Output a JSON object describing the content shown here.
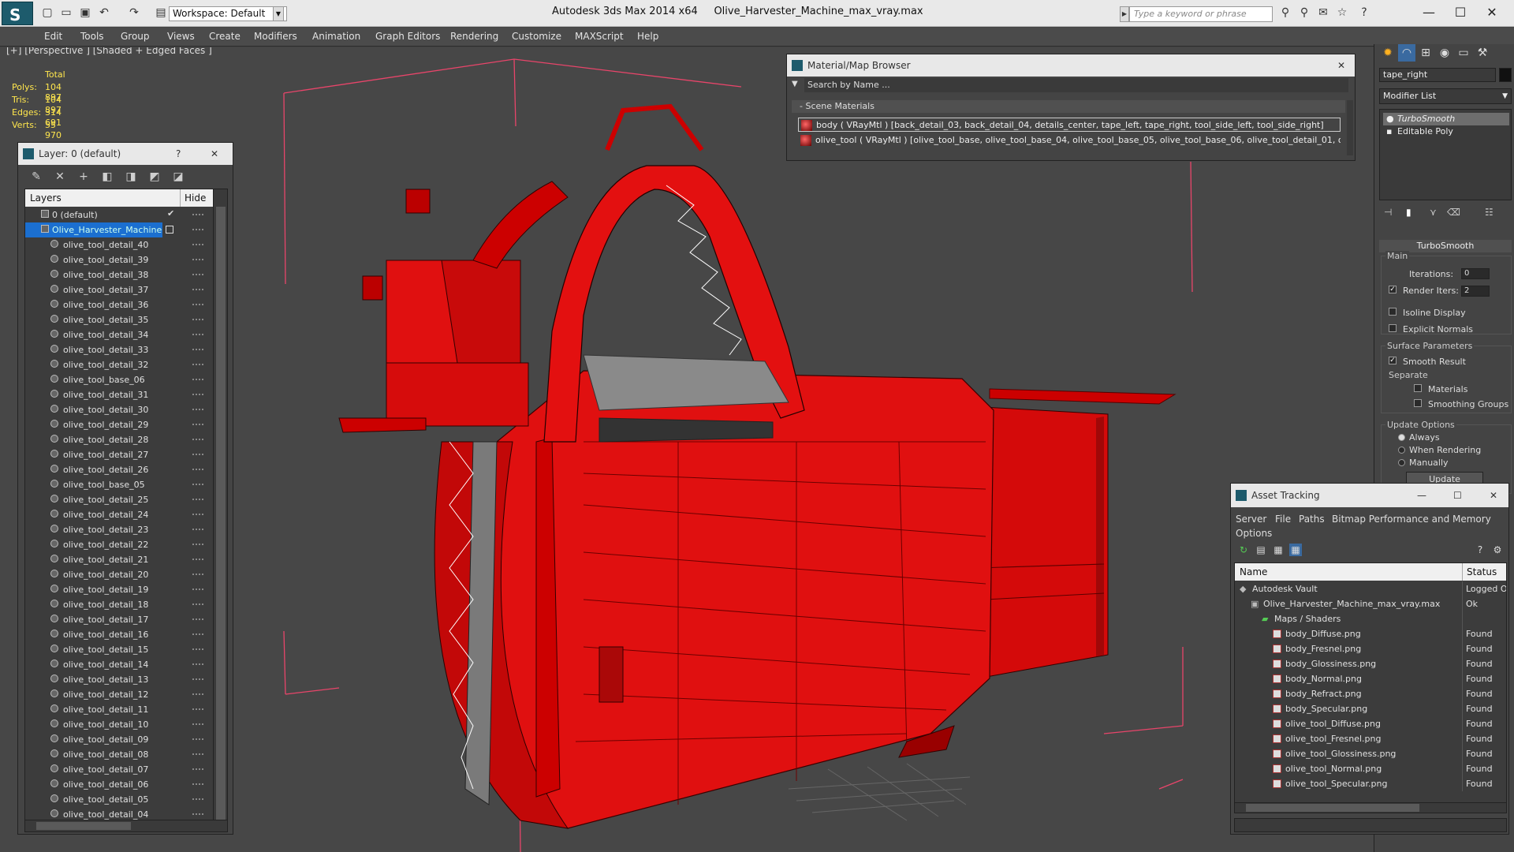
{
  "app": {
    "title": "Autodesk 3ds Max  2014 x64",
    "file": "Olive_Harvester_Machine_max_vray.max",
    "workspace": "Workspace: Default",
    "search_placeholder": "Type a keyword or phrase",
    "accent_color": "#1d5b6c"
  },
  "menu": [
    "Edit",
    "Tools",
    "Group",
    "Views",
    "Create",
    "Modifiers",
    "Animation",
    "Graph Editors",
    "Rendering",
    "Customize",
    "MAXScript",
    "Help"
  ],
  "viewport": {
    "label": "[+] [Perspective ] [Shaded + Edged Faces ]",
    "stats_header": "Total",
    "stats": [
      {
        "k": "Polys:",
        "v": "104 897"
      },
      {
        "k": "Tris:",
        "v": "104 897"
      },
      {
        "k": "Edges:",
        "v": "314 691"
      },
      {
        "k": "Verts:",
        "v": "55 970"
      }
    ],
    "model_color": "#e31010",
    "bbox_color": "#e8456a"
  },
  "layer_panel": {
    "title": "Layer: 0 (default)",
    "help": "?",
    "close": "✕",
    "col_layers": "Layers",
    "col_hide": "Hide",
    "default_layer": "0 (default)",
    "selected_layer": "Olive_Harvester_Machine",
    "items": [
      "olive_tool_detail_40",
      "olive_tool_detail_39",
      "olive_tool_detail_38",
      "olive_tool_detail_37",
      "olive_tool_detail_36",
      "olive_tool_detail_35",
      "olive_tool_detail_34",
      "olive_tool_detail_33",
      "olive_tool_detail_32",
      "olive_tool_base_06",
      "olive_tool_detail_31",
      "olive_tool_detail_30",
      "olive_tool_detail_29",
      "olive_tool_detail_28",
      "olive_tool_detail_27",
      "olive_tool_detail_26",
      "olive_tool_base_05",
      "olive_tool_detail_25",
      "olive_tool_detail_24",
      "olive_tool_detail_23",
      "olive_tool_detail_22",
      "olive_tool_detail_21",
      "olive_tool_detail_20",
      "olive_tool_detail_19",
      "olive_tool_detail_18",
      "olive_tool_detail_17",
      "olive_tool_detail_16",
      "olive_tool_detail_15",
      "olive_tool_detail_14",
      "olive_tool_detail_13",
      "olive_tool_detail_12",
      "olive_tool_detail_11",
      "olive_tool_detail_10",
      "olive_tool_detail_09",
      "olive_tool_detail_08",
      "olive_tool_detail_07",
      "olive_tool_detail_06",
      "olive_tool_detail_05",
      "olive_tool_detail_04"
    ]
  },
  "material_browser": {
    "title": "Material/Map Browser",
    "search": "Search by Name ...",
    "group": "Scene Materials",
    "materials": [
      "body ( VRayMtl ) [back_detail_03, back_detail_04, details_center, tape_left, tape_right, tool_side_left, tool_side_right]",
      "olive_tool ( VRayMtl ) [olive_tool_base, olive_tool_base_04, olive_tool_base_05, olive_tool_base_06, olive_tool_detail_01, olive_..."
    ]
  },
  "command_panel": {
    "object_name": "tape_right",
    "modifier_list": "Modifier List",
    "stack": [
      "TurboSmooth",
      "Editable Poly"
    ],
    "rollout": "TurboSmooth",
    "main_label": "Main",
    "iterations_label": "Iterations:",
    "iterations_value": "0",
    "render_iters_label": "Render Iters:",
    "render_iters_value": "2",
    "isoline": "Isoline Display",
    "explicit_normals": "Explicit Normals",
    "surface_params": "Surface Parameters",
    "smooth_result": "Smooth Result",
    "separate": "Separate",
    "materials": "Materials",
    "smoothing_groups": "Smoothing Groups",
    "update_options": "Update Options",
    "always": "Always",
    "when_rendering": "When Rendering",
    "manually": "Manually",
    "update_button": "Update"
  },
  "asset_tracking": {
    "title": "Asset Tracking",
    "menu": [
      "Server",
      "File",
      "Paths",
      "Bitmap Performance and Memory",
      "Options"
    ],
    "col_name": "Name",
    "col_status": "Status",
    "rows": [
      {
        "name": "Autodesk Vault",
        "status": "Logged O"
      },
      {
        "name": "Olive_Harvester_Machine_max_vray.max",
        "status": "Ok"
      },
      {
        "name": "Maps / Shaders",
        "status": ""
      },
      {
        "name": "body_Diffuse.png",
        "status": "Found"
      },
      {
        "name": "body_Fresnel.png",
        "status": "Found"
      },
      {
        "name": "body_Glossiness.png",
        "status": "Found"
      },
      {
        "name": "body_Normal.png",
        "status": "Found"
      },
      {
        "name": "body_Refract.png",
        "status": "Found"
      },
      {
        "name": "body_Specular.png",
        "status": "Found"
      },
      {
        "name": "olive_tool_Diffuse.png",
        "status": "Found"
      },
      {
        "name": "olive_tool_Fresnel.png",
        "status": "Found"
      },
      {
        "name": "olive_tool_Glossiness.png",
        "status": "Found"
      },
      {
        "name": "olive_tool_Normal.png",
        "status": "Found"
      },
      {
        "name": "olive_tool_Specular.png",
        "status": "Found"
      }
    ]
  }
}
